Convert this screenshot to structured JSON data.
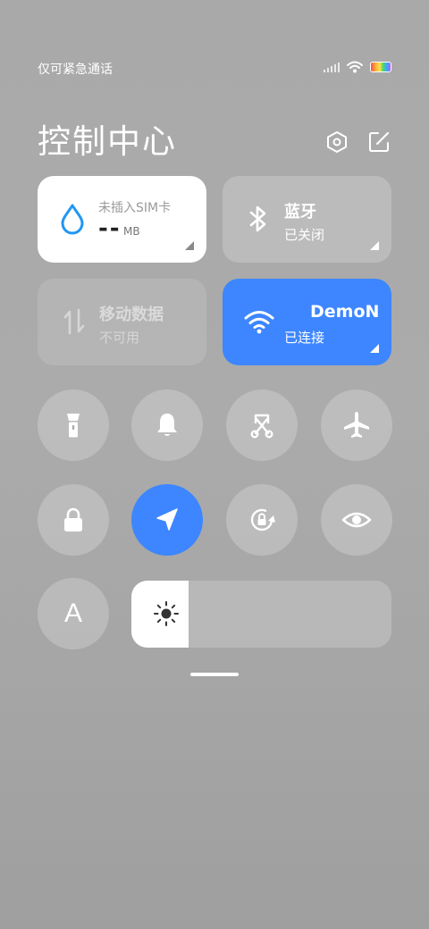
{
  "status": {
    "carrier_text": "仅可紧急通话"
  },
  "header": {
    "title": "控制中心"
  },
  "tiles": {
    "sim": {
      "label": "未插入SIM卡",
      "value": "--",
      "unit": "MB"
    },
    "bluetooth": {
      "title": "蓝牙",
      "subtitle": "已关闭"
    },
    "mobile_data": {
      "title": "移动数据",
      "subtitle": "不可用"
    },
    "wifi": {
      "title": "DemoN",
      "subtitle": "已连接"
    }
  },
  "quick_toggles": {
    "flashlight": {
      "active": false
    },
    "bell": {
      "active": false
    },
    "screenshot": {
      "active": false
    },
    "airplane": {
      "active": false
    },
    "lock": {
      "active": false
    },
    "location": {
      "active": true
    },
    "rotation_lock": {
      "active": false
    },
    "reading_mode": {
      "active": false
    },
    "font_size": {
      "label": "A",
      "active": false
    }
  },
  "brightness": {
    "level": 0.22
  },
  "colors": {
    "accent": "#3d86ff",
    "sim_icon": "#2196f3"
  },
  "icons": {
    "settings": "hexagon-gear-icon",
    "edit": "edit-square-icon"
  }
}
